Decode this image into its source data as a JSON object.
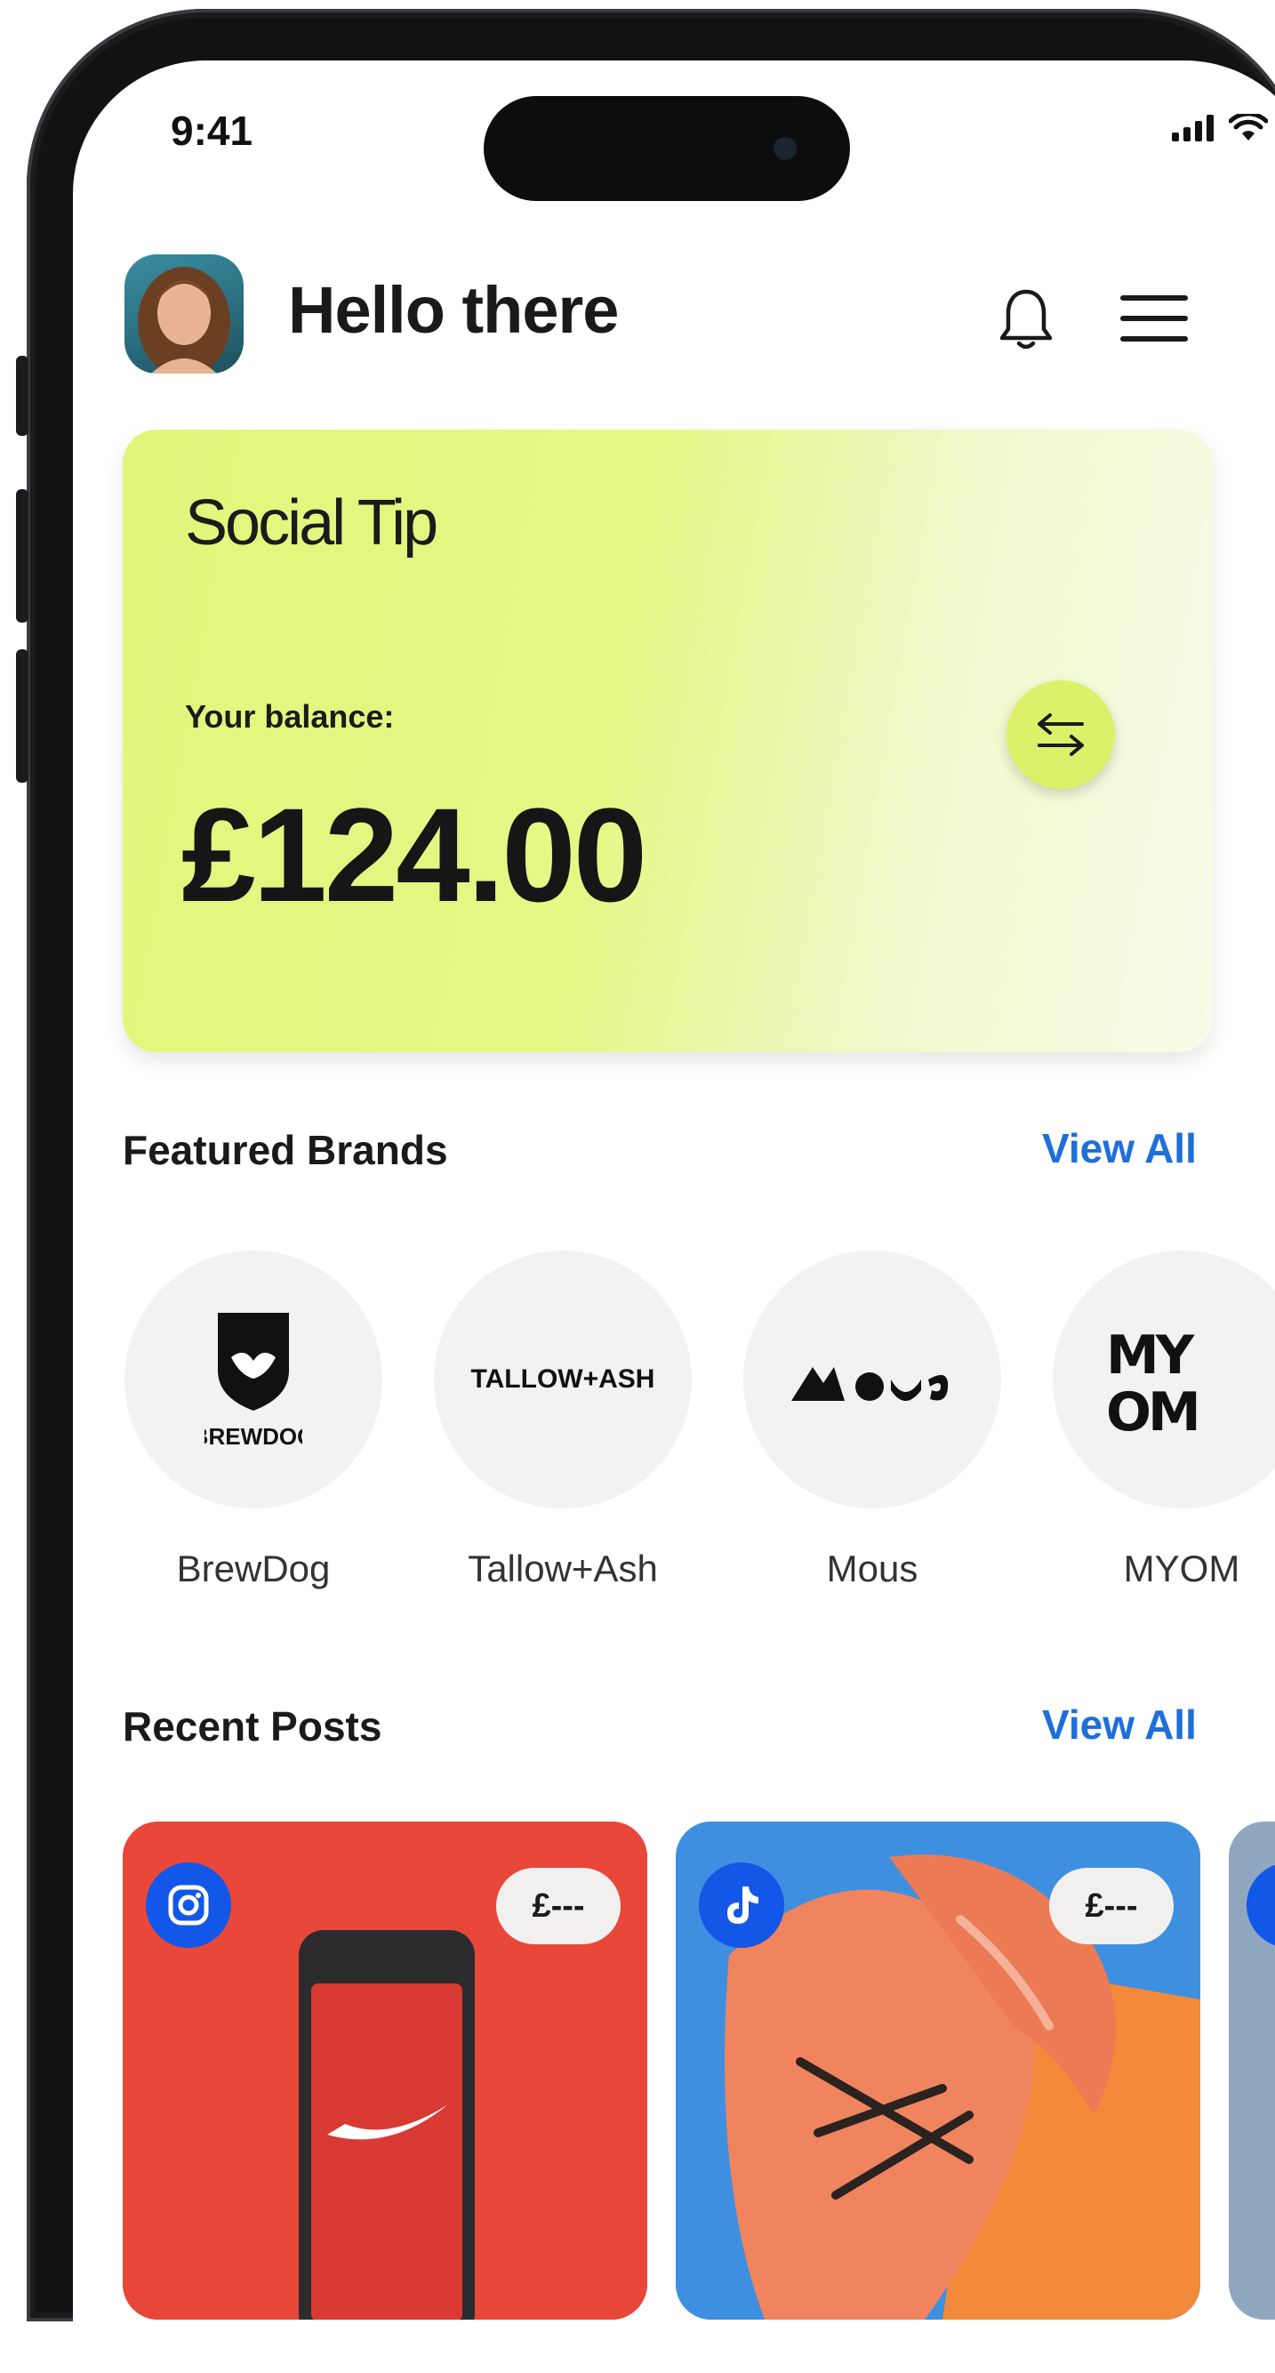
{
  "status_bar": {
    "time": "9:41"
  },
  "header": {
    "greeting": "Hello there"
  },
  "balance_card": {
    "title": "Social Tip",
    "label": "Your balance:",
    "amount": "£124.00"
  },
  "featured_brands": {
    "title": "Featured Brands",
    "view_all": "View All",
    "items": [
      {
        "name": "BrewDog",
        "logo_text": "BREWDOG"
      },
      {
        "name": "Tallow+Ash",
        "logo_text": "TALLOW+ASH"
      },
      {
        "name": "Mous",
        "logo_text": "MOUS"
      },
      {
        "name": "MYOM",
        "logo_text": "MYOM"
      }
    ]
  },
  "recent_posts": {
    "title": "Recent Posts",
    "view_all": "View All",
    "items": [
      {
        "platform_icon": "instagram-icon",
        "price": "£---"
      },
      {
        "platform_icon": "tiktok-icon",
        "price": "£---"
      }
    ]
  },
  "colors": {
    "accent_blue": "#1e6fd9",
    "card_green": "#e2f57a",
    "social_badge_blue": "#1357e8"
  }
}
